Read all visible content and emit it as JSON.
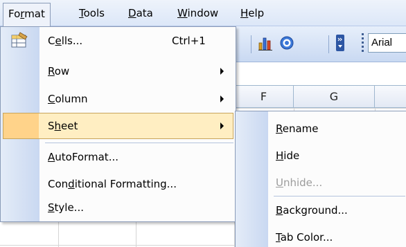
{
  "menubar": {
    "items": [
      {
        "label_pre": "Fo",
        "label_u": "r",
        "label_post": "mat"
      },
      {
        "label_pre": "",
        "label_u": "T",
        "label_post": "ools"
      },
      {
        "label_pre": "",
        "label_u": "D",
        "label_post": "ata"
      },
      {
        "label_pre": "",
        "label_u": "W",
        "label_post": "indow"
      },
      {
        "label_pre": "",
        "label_u": "H",
        "label_post": "elp"
      }
    ]
  },
  "toolbar": {
    "font_name": "Arial",
    "icons": [
      "chart-wizard-icon",
      "help-icon",
      "toolbar-options-icon"
    ]
  },
  "columns": [
    "F",
    "G"
  ],
  "format_menu": {
    "items": [
      {
        "pre": "C",
        "u": "e",
        "post": "lls...",
        "shortcut": "Ctrl+1"
      },
      {
        "pre": "",
        "u": "R",
        "post": "ow"
      },
      {
        "pre": "",
        "u": "C",
        "post": "olumn"
      },
      {
        "pre": "S",
        "u": "h",
        "post": "eet"
      },
      {
        "pre": "",
        "u": "A",
        "post": "utoFormat..."
      },
      {
        "pre": "Con",
        "u": "d",
        "post": "itional Formatting..."
      },
      {
        "pre": "",
        "u": "S",
        "post": "tyle..."
      }
    ],
    "highlighted": "Sheet"
  },
  "sheet_submenu": {
    "items": [
      {
        "pre": "",
        "u": "R",
        "post": "ename"
      },
      {
        "pre": "",
        "u": "H",
        "post": "ide"
      },
      {
        "pre": "",
        "u": "U",
        "post": "nhide..."
      },
      {
        "pre": "",
        "u": "B",
        "post": "ackground..."
      },
      {
        "pre": "",
        "u": "T",
        "post": "ab Color..."
      }
    ],
    "disabled": [
      "Unhide..."
    ]
  },
  "colors": {
    "highlight_bg": "#ffeec2",
    "highlight_border": "#c8a45a",
    "menu_gutter": "#c9d8f1",
    "disabled_text": "#9c9c9c"
  }
}
